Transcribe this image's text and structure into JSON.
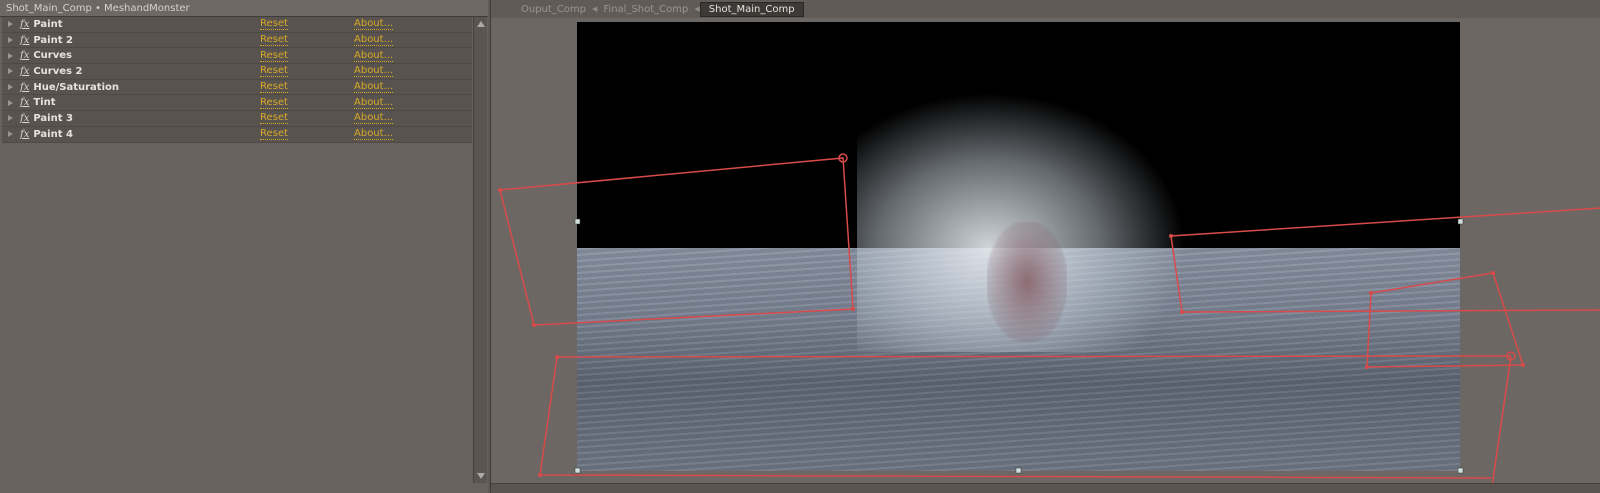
{
  "effects_panel": {
    "title": "Shot_Main_Comp • MeshandMonster",
    "effects": [
      {
        "name": "Paint",
        "reset": "Reset",
        "about": "About..."
      },
      {
        "name": "Paint 2",
        "reset": "Reset",
        "about": "About..."
      },
      {
        "name": "Curves",
        "reset": "Reset",
        "about": "About..."
      },
      {
        "name": "Curves 2",
        "reset": "Reset",
        "about": "About..."
      },
      {
        "name": "Hue/Saturation",
        "reset": "Reset",
        "about": "About..."
      },
      {
        "name": "Tint",
        "reset": "Reset",
        "about": "About..."
      },
      {
        "name": "Paint 3",
        "reset": "Reset",
        "about": "About..."
      },
      {
        "name": "Paint 4",
        "reset": "Reset",
        "about": "About..."
      }
    ],
    "fx_glyph": "fx"
  },
  "viewer": {
    "breadcrumbs": [
      "Ouput_Comp",
      "Final_Shot_Comp",
      "Shot_Main_Comp"
    ],
    "active_comp": "Shot_Main_Comp",
    "mask_color": "#d94a4a",
    "link_color": "#d7a927"
  }
}
